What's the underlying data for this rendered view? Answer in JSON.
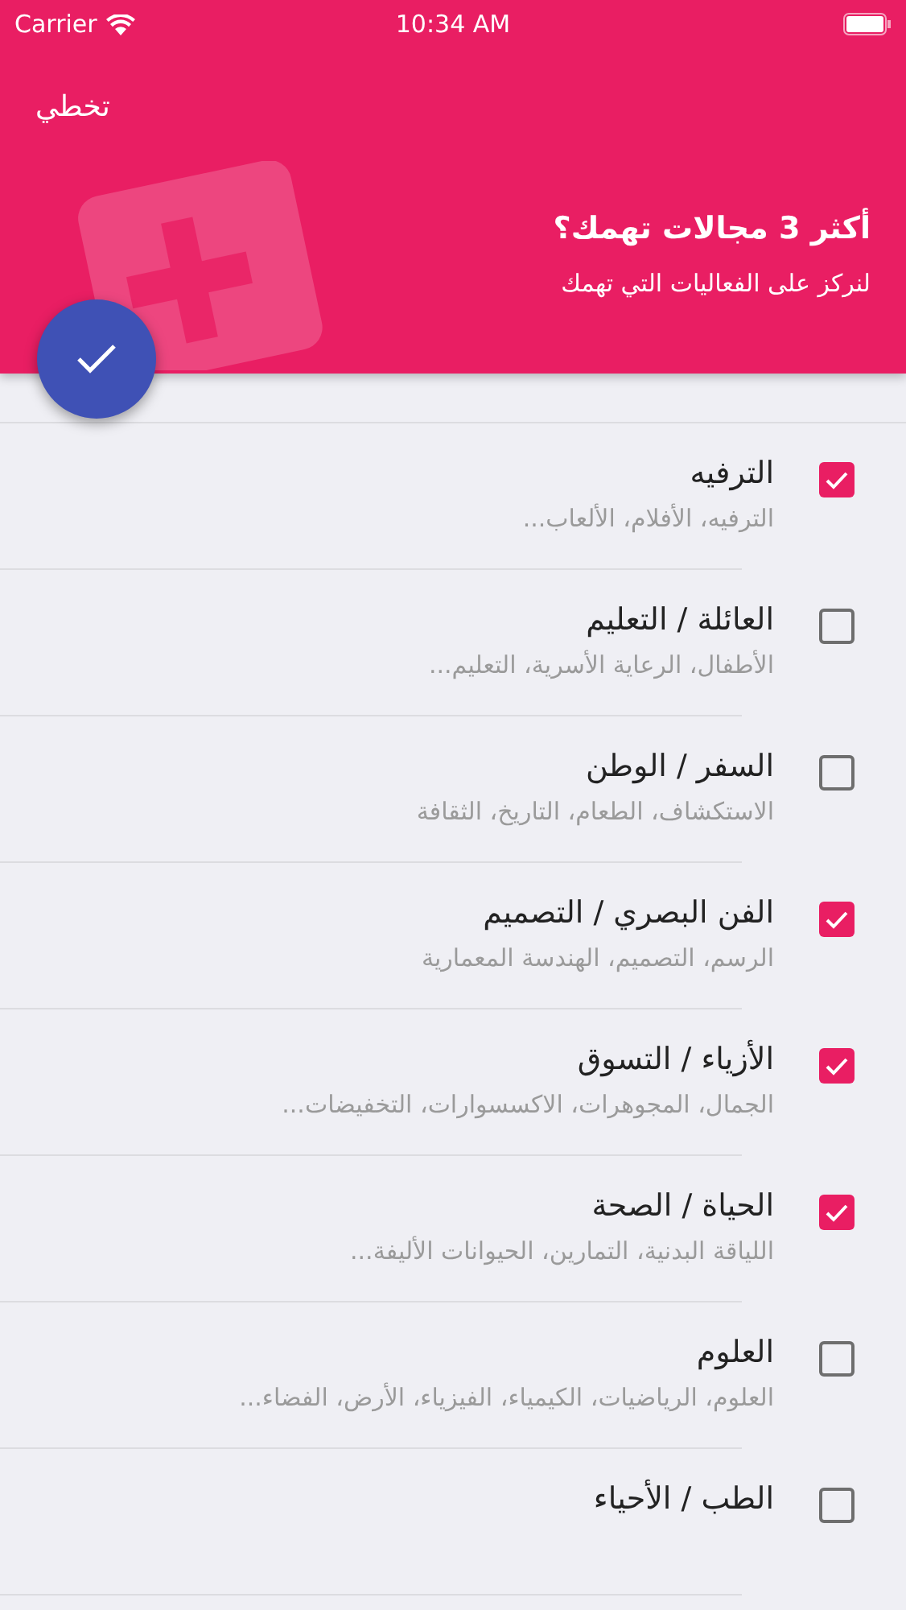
{
  "status_bar": {
    "carrier": "Carrier",
    "time": "10:34 AM"
  },
  "header": {
    "skip": "تخطي",
    "title": "أكثر 3 مجالات تهمك؟",
    "subtitle": "لنركز على الفعاليات التي تهمك"
  },
  "categories": [
    {
      "title": "الترفيه",
      "description": "الترفيه، الأفلام، الألعاب...",
      "checked": true
    },
    {
      "title": "العائلة / التعليم",
      "description": "الأطفال، الرعاية الأسرية، التعليم...",
      "checked": false
    },
    {
      "title": "السفر / الوطن",
      "description": "الاستكشاف، الطعام، التاريخ، الثقافة",
      "checked": false
    },
    {
      "title": "الفن البصري / التصميم",
      "description": "الرسم، التصميم، الهندسة المعمارية",
      "checked": true
    },
    {
      "title": "الأزياء / التسوق",
      "description": "الجمال، المجوهرات، الاكسسوارات، التخفيضات...",
      "checked": true
    },
    {
      "title": "الحياة / الصحة",
      "description": "اللياقة البدنية، التمارين، الحيوانات الأليفة...",
      "checked": true
    },
    {
      "title": "العلوم",
      "description": "العلوم، الرياضيات، الكيمياء، الفيزياء، الأرض، الفضاء...",
      "checked": false
    },
    {
      "title": "الطب / الأحياء",
      "checked": false
    }
  ]
}
